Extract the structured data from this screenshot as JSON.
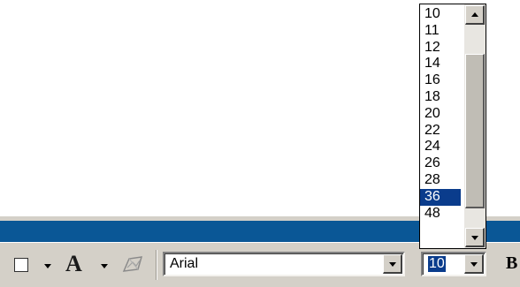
{
  "toolbar": {
    "font_name": "Arial",
    "font_size": "10",
    "bold_label": "B",
    "font_color_label": "A"
  },
  "size_list": {
    "items": [
      "10",
      "11",
      "12",
      "14",
      "16",
      "18",
      "20",
      "22",
      "24",
      "26",
      "28",
      "36",
      "48"
    ],
    "selected": "36"
  },
  "colors": {
    "title_bar": "#0a5796",
    "selection": "#0a3c8c",
    "toolbar_bg": "#d4d0c8"
  },
  "icons": {
    "fill": "fill-color-icon",
    "font_color": "font-color-icon",
    "special": "special-effects-icon"
  }
}
